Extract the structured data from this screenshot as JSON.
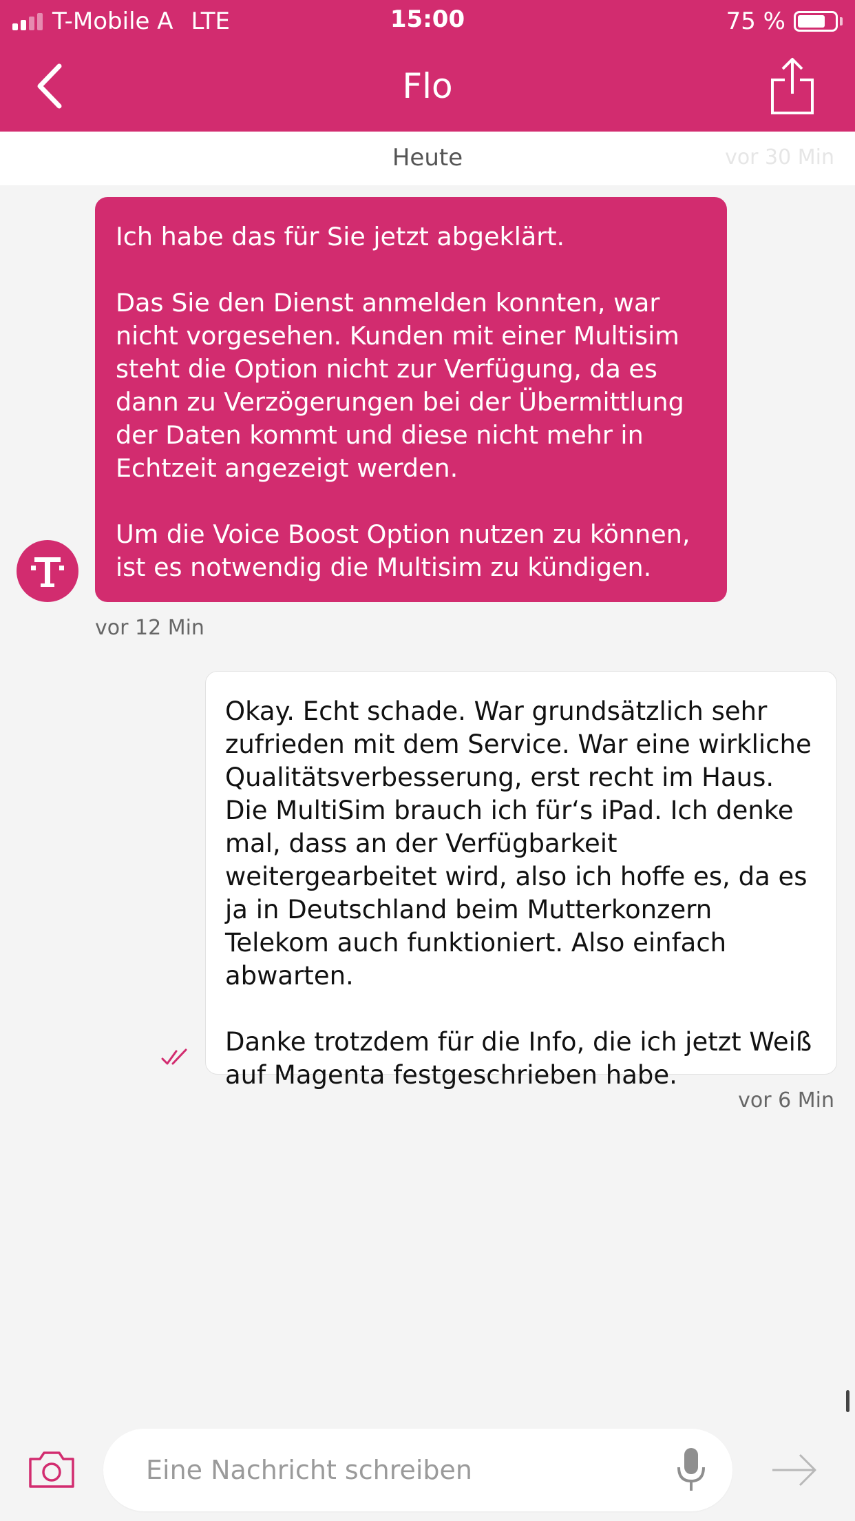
{
  "status_bar": {
    "carrier": "T-Mobile A",
    "network": "LTE",
    "time": "15:00",
    "battery_percent": "75 %",
    "battery_level": 0.75
  },
  "nav": {
    "title": "Flo",
    "back_icon": "chevron-left-icon",
    "share_icon": "share-icon"
  },
  "day_bar": {
    "label": "Heute",
    "ago": "vor 30 Min"
  },
  "messages": [
    {
      "direction": "incoming",
      "text": "Ich habe das für Sie jetzt abgeklärt.\n\nDas Sie den Dienst anmelden konnten, war nicht vorgesehen. Kunden mit einer Multisim steht die Option nicht zur Verfügung, da es dann zu Verzögerungen bei der Übermittlung der Daten kommt und diese nicht mehr in Echtzeit angezeigt werden.\n\nUm die Voice Boost Option nutzen zu können, ist es notwendig die Multisim zu kündigen.",
      "time": "vor 12 Min"
    },
    {
      "direction": "outgoing",
      "text": "Okay. Echt schade. War grundsätzlich sehr zufrieden mit dem Service. War eine wirkliche Qualitätsverbesserung, erst recht im Haus.\nDie MultiSim brauch ich für‘s iPad. Ich denke mal, dass an der Verfügbarkeit weitergearbeitet wird, also ich hoffe es, da es ja in Deutschland beim Mutterkonzern Telekom auch funktioniert. Also einfach abwarten.\n\nDanke trotzdem für die Info, die ich jetzt Weiß auf Magenta festgeschrieben habe.",
      "time": "vor 6 Min",
      "status_icon": "double-check-icon"
    }
  ],
  "composer": {
    "placeholder": "Eine Nachricht schreiben",
    "camera_icon": "camera-icon",
    "mic_icon": "microphone-icon",
    "send_icon": "send-arrow-icon"
  },
  "colors": {
    "brand": "#d22c6f",
    "background": "#f4f4f4"
  }
}
